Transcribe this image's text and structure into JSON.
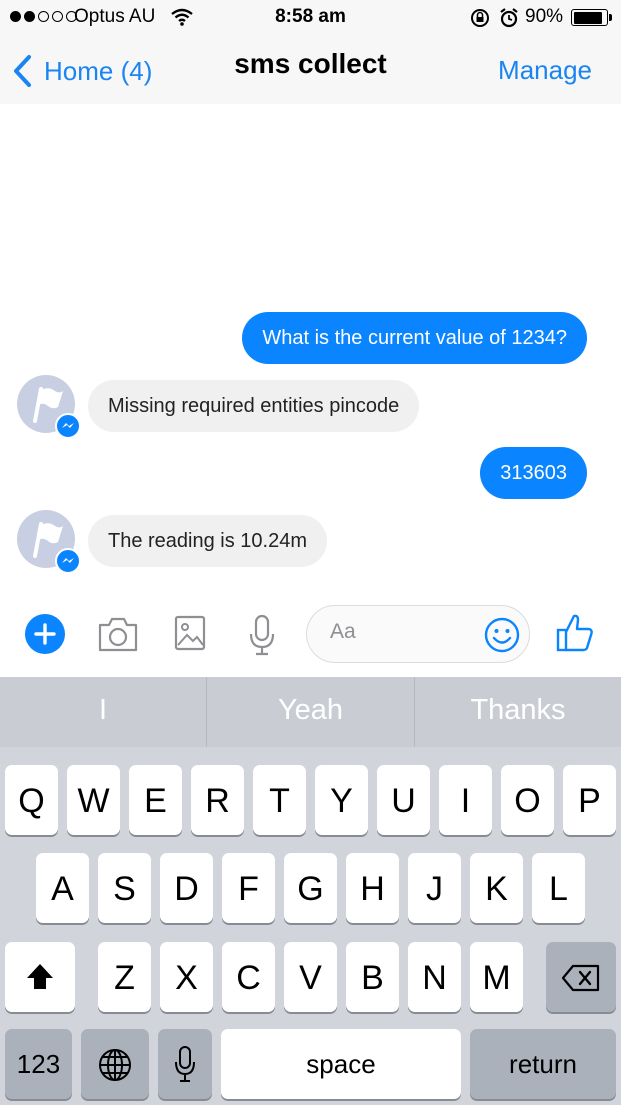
{
  "status_bar": {
    "carrier": "Optus AU",
    "time": "8:58 am",
    "battery": "90%",
    "battery_level": 0.9
  },
  "nav": {
    "back_label": "Home (4)",
    "title": "sms collect",
    "right_label": "Manage"
  },
  "messages": {
    "m1": "What is the current value of 1234?",
    "m2": "Missing required entities pincode",
    "m3": "313603",
    "m4": "The reading is 10.24m"
  },
  "composer": {
    "placeholder": "Aa"
  },
  "keyboard": {
    "suggestions": [
      "I",
      "Yeah",
      "Thanks"
    ],
    "row1": [
      "Q",
      "W",
      "E",
      "R",
      "T",
      "Y",
      "U",
      "I",
      "O",
      "P"
    ],
    "row2": [
      "A",
      "S",
      "D",
      "F",
      "G",
      "H",
      "J",
      "K",
      "L"
    ],
    "row3": [
      "Z",
      "X",
      "C",
      "V",
      "B",
      "N",
      "M"
    ],
    "numbers_label": "123",
    "space_label": "space",
    "return_label": "return"
  },
  "colors": {
    "accent": "#0a84ff",
    "incoming_bubble": "#f1f0f0"
  }
}
